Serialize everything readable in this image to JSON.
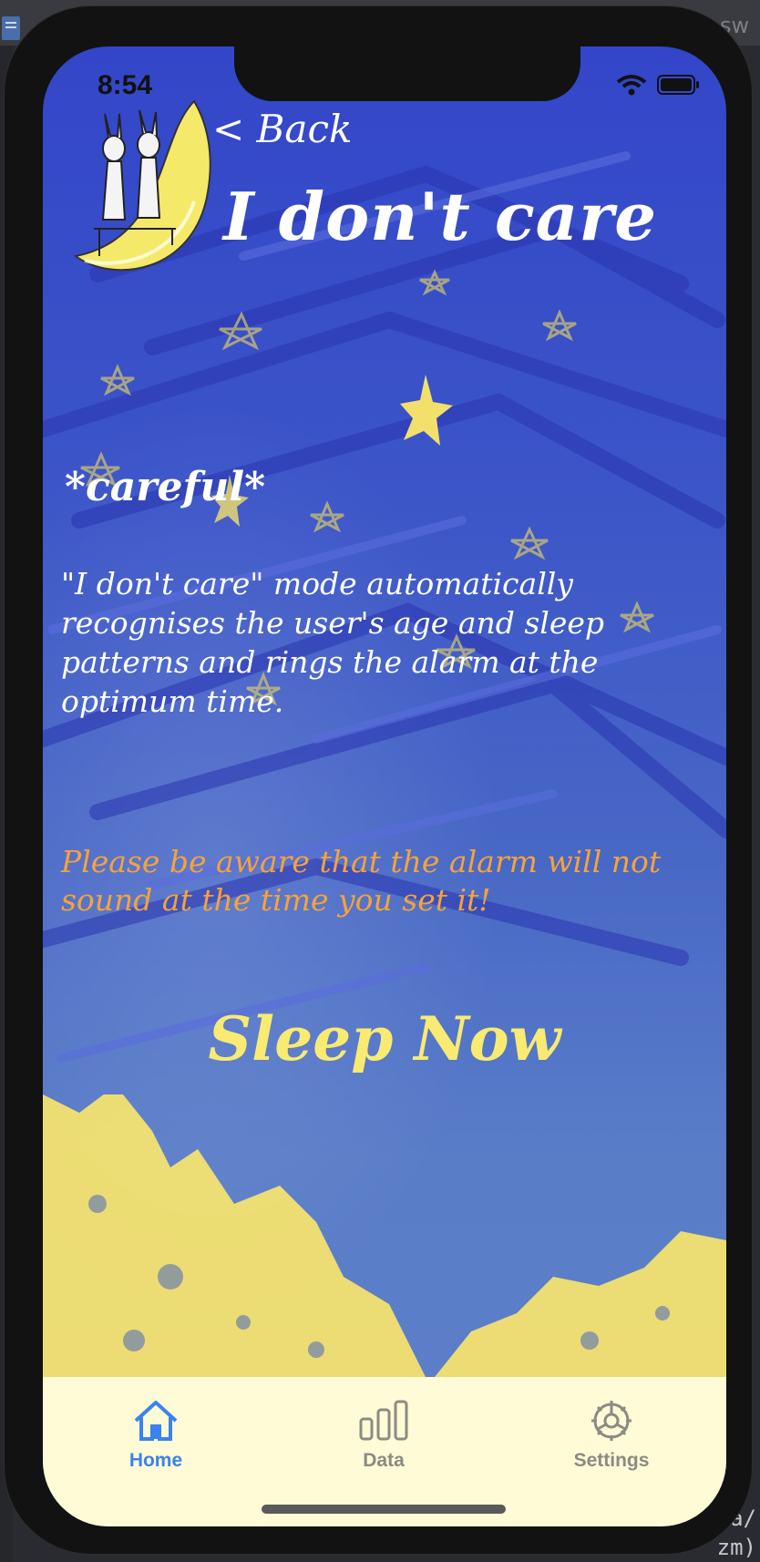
{
  "status_bar": {
    "time": "8:54"
  },
  "nav": {
    "back_label": "< Back"
  },
  "page": {
    "title": "I don't care",
    "subtitle": "*careful*",
    "description": "\"I don't care\" mode automatically recognises the user's age and sleep patterns and rings the alarm at the optimum time.",
    "warning": "Please be aware that the alarm will not sound at the time you set it!",
    "primary_action": "Sleep Now"
  },
  "tab_bar": {
    "items": [
      {
        "label": "Home",
        "icon": "home-icon",
        "selected": true
      },
      {
        "label": "Data",
        "icon": "bar-chart-icon",
        "selected": false
      },
      {
        "label": "Settings",
        "icon": "gear-icon",
        "selected": false
      }
    ]
  },
  "colors": {
    "background_blue": "#3c55c8",
    "warning_orange": "#f6a23a",
    "button_yellow": "#f9ea72",
    "tab_active": "#3a82f0",
    "tab_inactive": "#8b8b83",
    "tab_bar_bg": "#fefbd6"
  },
  "desktop": {
    "tab_fragment": "or.sw",
    "code_fragment": "a/\nzm)"
  }
}
